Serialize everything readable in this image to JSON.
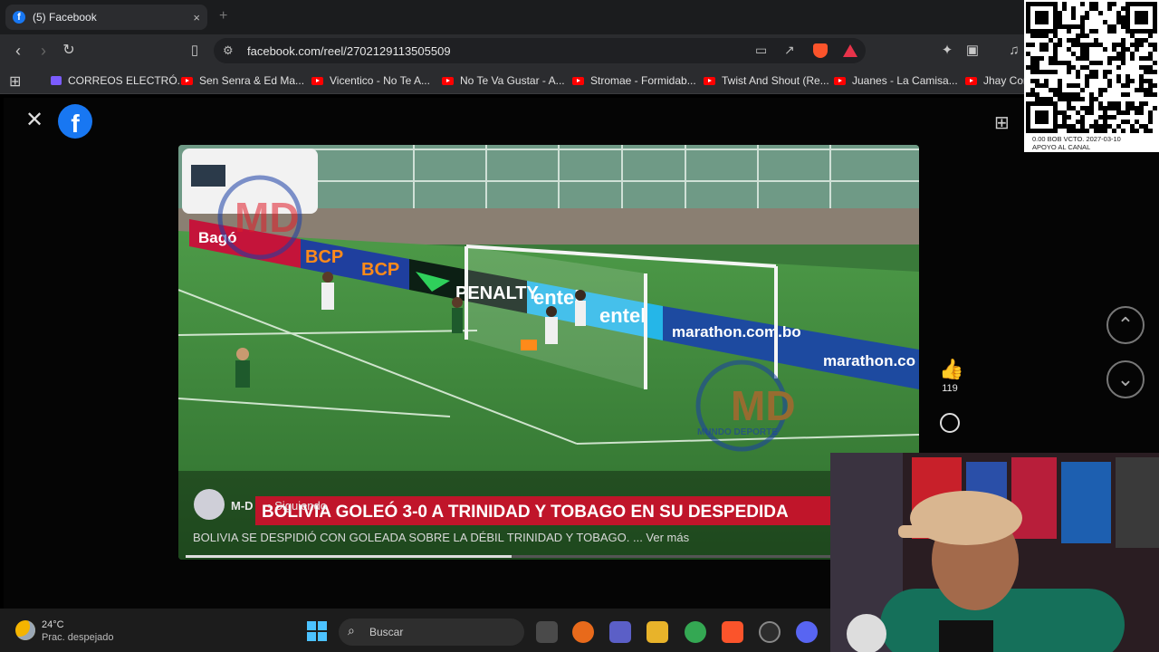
{
  "browser": {
    "tab_title": "(5) Facebook",
    "tab_close": "×",
    "new_tab": "+",
    "url": "facebook.com/reel/2702129113505509",
    "bookmarks": [
      "CORREOS ELECTRÓ...",
      "Sen Senra & Ed Ma...",
      "Vicentico - No Te A...",
      "No Te Va Gustar - A...",
      "Stromae - Formidab...",
      "Twist And Shout (Re...",
      "Juanes - La Camisa...",
      "Jhay Cort"
    ]
  },
  "reel": {
    "author": "M-D",
    "follow_status": "• Siguiendo",
    "headline_overlay": "BOLIVIA GOLEÓ 3-0 A TRINIDAD Y TOBAGO EN SU DESPEDIDA",
    "caption": "BOLIVIA SE DESPIDIÓ CON GOLEADA SOBRE LA DÉBIL TRINIDAD Y TOBAGO. ... Ver más",
    "like_count": "119",
    "progress_fraction": 0.45,
    "watermark": "MUNDO DEPORTE",
    "ads": [
      "Bagó",
      "BCP",
      "BCP",
      "PENALTY",
      "entel",
      "entel",
      "marathon.com.bo",
      "marathon.co"
    ]
  },
  "qr_overlay": {
    "line1": "0.00 BOB  VCTO. 2027-03-10",
    "line2": "APOYO AL CANAL"
  },
  "taskbar": {
    "temperature": "24°C",
    "weather": "Prac. despejado",
    "search_placeholder": "Buscar"
  },
  "colors": {
    "facebook_blue": "#1877f2",
    "headline_red": "#c0152a",
    "pitch_green": "#3f8a3c"
  }
}
